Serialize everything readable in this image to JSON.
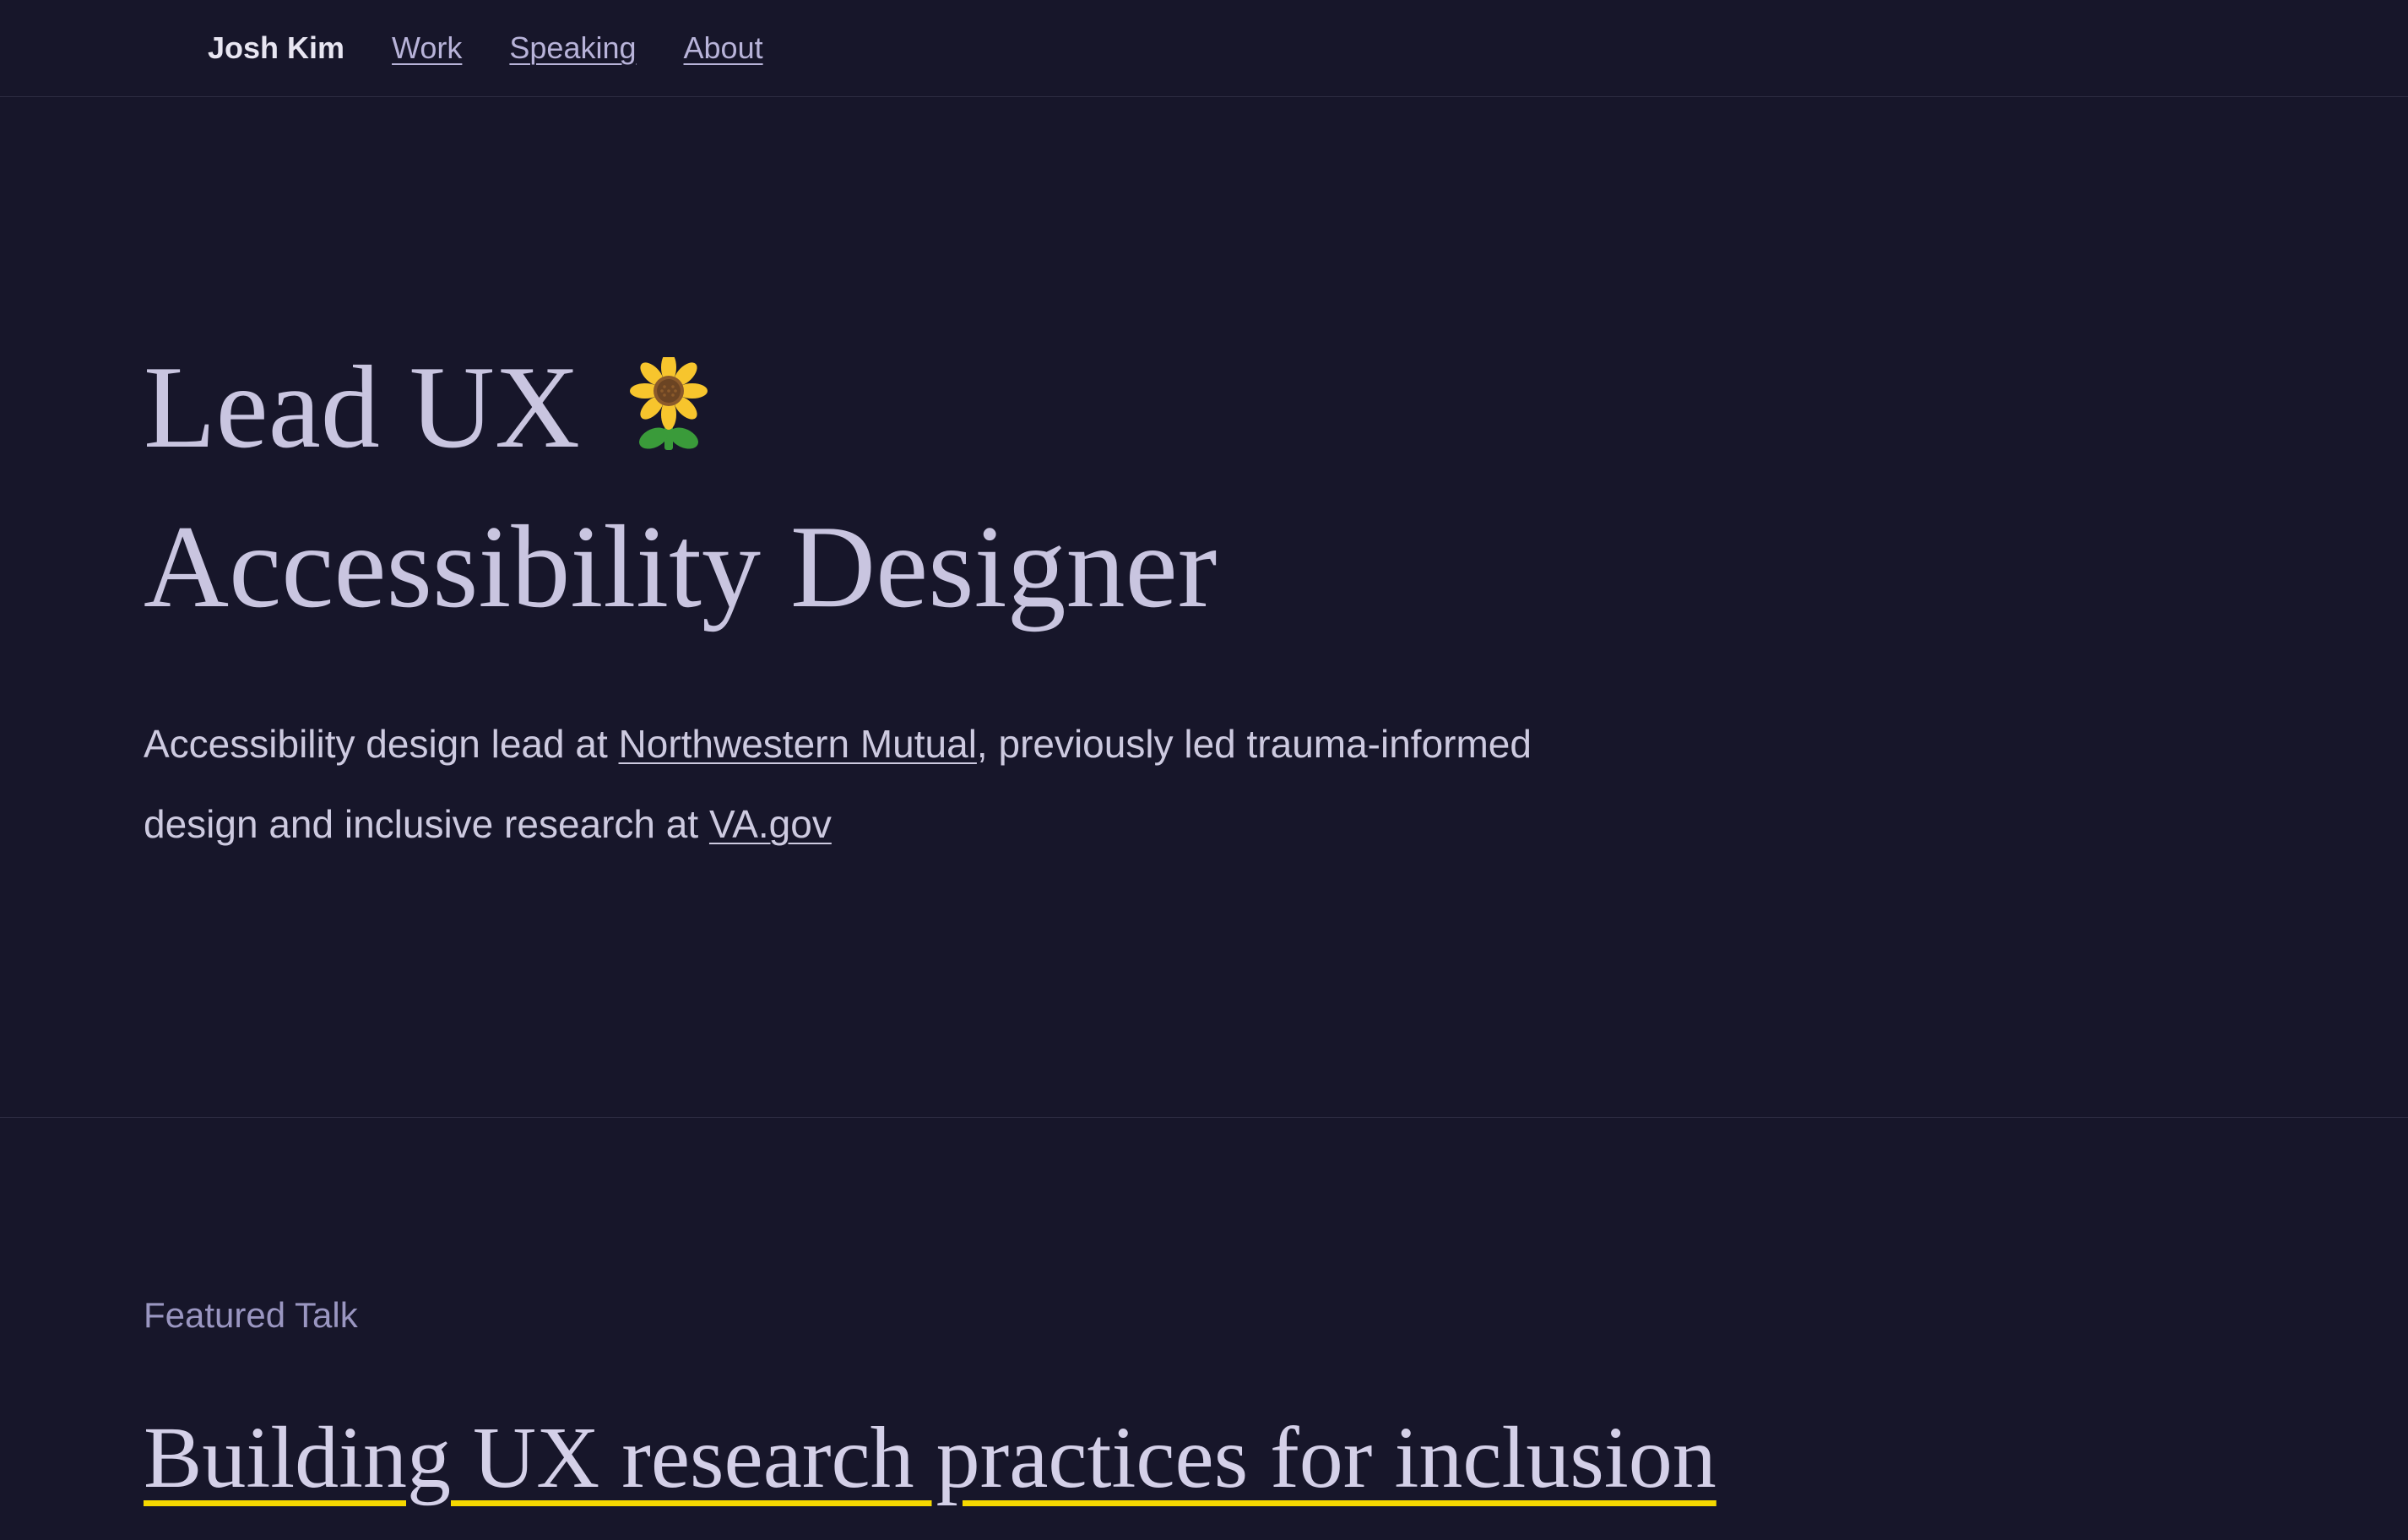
{
  "nav": {
    "brand": "Josh Kim",
    "links": [
      {
        "label": "Work"
      },
      {
        "label": "Speaking"
      },
      {
        "label": "About"
      }
    ]
  },
  "hero": {
    "title_line1": "Lead UX",
    "title_line2": "Accessibility Designer",
    "description_part1": "Accessibility design lead at ",
    "description_link1": "Northwestern Mutual",
    "description_part2": ", previously led trauma-informed design and inclusive research at ",
    "description_link2": "VA.gov"
  },
  "featured": {
    "label": "Featured Talk",
    "title": "Building UX research practices for inclusion"
  }
}
